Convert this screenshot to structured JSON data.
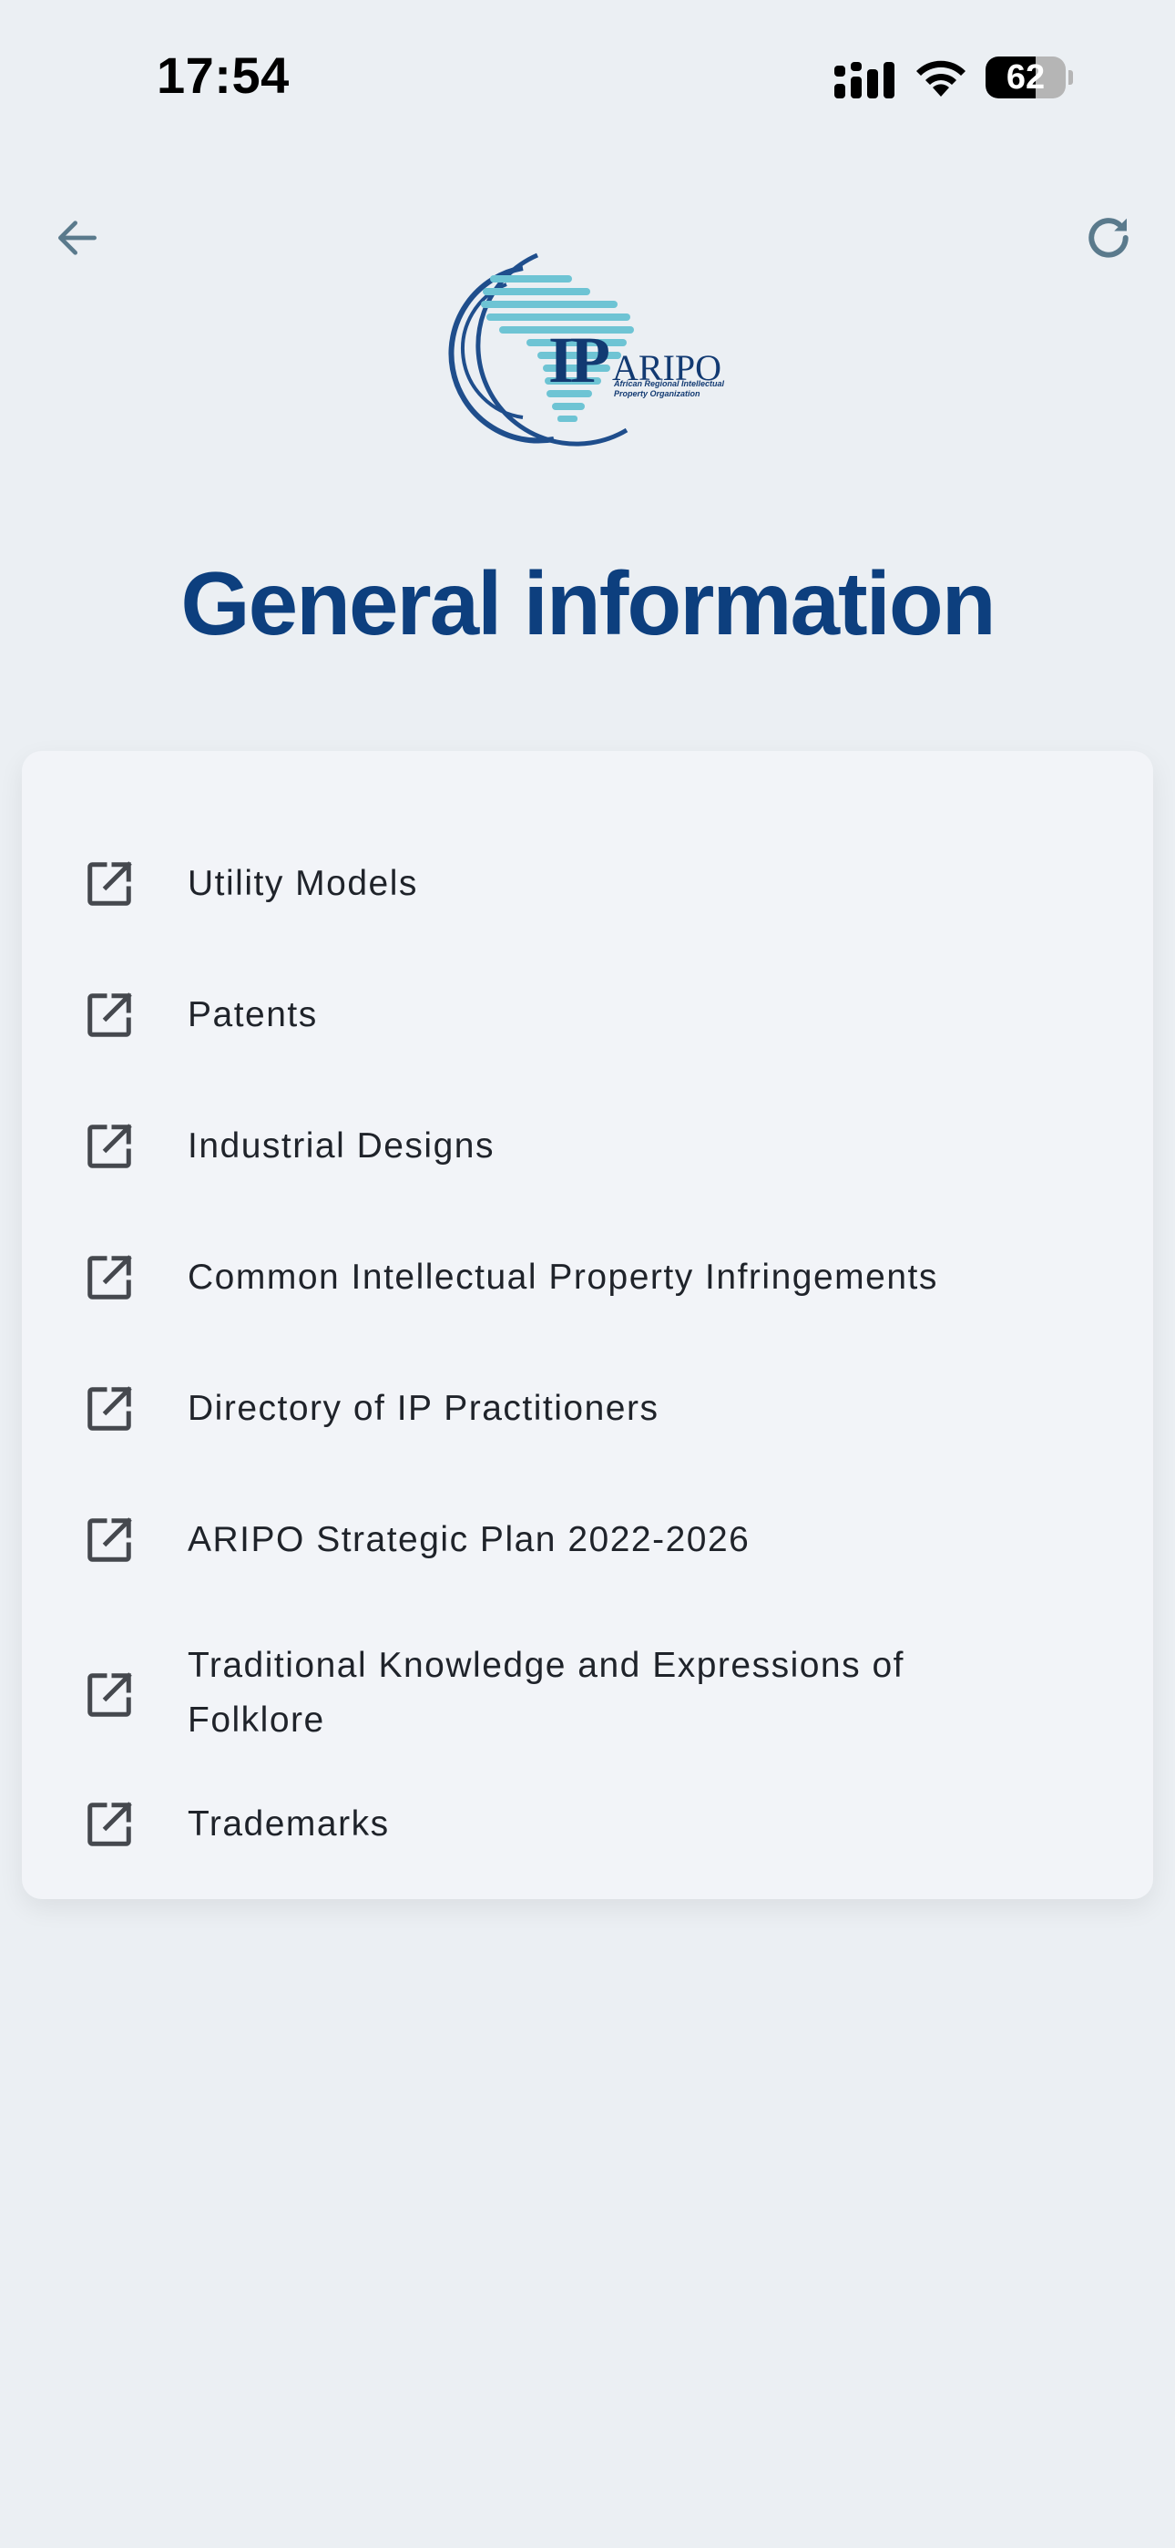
{
  "status_bar": {
    "time": "17:54",
    "battery": "62",
    "battery_level": 0.62
  },
  "header": {
    "back_icon": "arrow-left-icon",
    "refresh_icon": "refresh-icon",
    "icon_color": "#5a7a8c"
  },
  "logo": {
    "ip": "IP",
    "name": "ARIPO",
    "subtitle": "African Regional Intellectual Property Organization"
  },
  "page": {
    "title": "General information",
    "title_color": "#0d3f7e"
  },
  "list": {
    "item_icon": "external-link-icon",
    "items": [
      {
        "label": "Utility Models"
      },
      {
        "label": "Patents"
      },
      {
        "label": "Industrial Designs"
      },
      {
        "label": "Common Intellectual Property Infringements"
      },
      {
        "label": "Directory of IP Practitioners"
      },
      {
        "label": "ARIPO Strategic Plan 2022-2026"
      },
      {
        "label": "Traditional Knowledge and Expressions of Folklore"
      },
      {
        "label": "Trademarks"
      }
    ]
  }
}
